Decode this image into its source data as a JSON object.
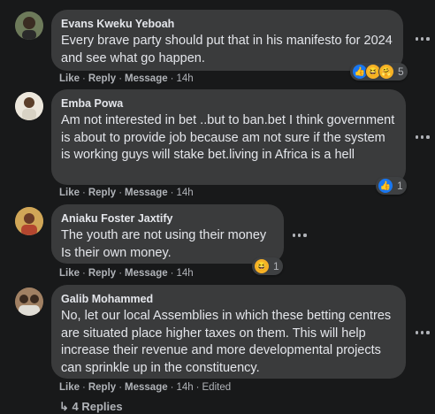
{
  "comments": [
    {
      "author": "Evans Kweku Yeboah",
      "text": "Every brave party should put that in his manifesto for 2024 and see what go happen.",
      "like": "Like",
      "reply": "Reply",
      "message": "Message",
      "time": "14h",
      "reactions": [
        "like",
        "haha",
        "care"
      ],
      "reaction_count": "5"
    },
    {
      "author": "Emba Powa",
      "text": "Am not interested in bet ..but to ban.bet I think government is about to provide job because am not sure if the system is working guys will stake bet.living in Africa is a hell",
      "like": "Like",
      "reply": "Reply",
      "message": "Message",
      "time": "14h",
      "reactions": [
        "like"
      ],
      "reaction_count": "1"
    },
    {
      "author": "Aniaku Foster Jaxtify",
      "text": "The youth are not using their money Is their own money.",
      "like": "Like",
      "reply": "Reply",
      "message": "Message",
      "time": "14h",
      "reactions": [
        "haha"
      ],
      "reaction_count": "1"
    },
    {
      "author": "Galib Mohammed",
      "text": "No, let our local Assemblies in which these betting centres are situated place higher taxes on them. This will help increase their revenue and more developmental projects can sprinkle up in the constituency.",
      "like": "Like",
      "reply": "Reply",
      "message": "Message",
      "time": "14h",
      "edited": "Edited"
    }
  ],
  "replies_label": "↳ 4 Replies",
  "colors": {
    "background": "#18191a",
    "bubble": "#3a3b3c",
    "muted": "#b0b3b8",
    "like_blue": "#1877f2",
    "emoji_yellow": "#f7b125"
  }
}
